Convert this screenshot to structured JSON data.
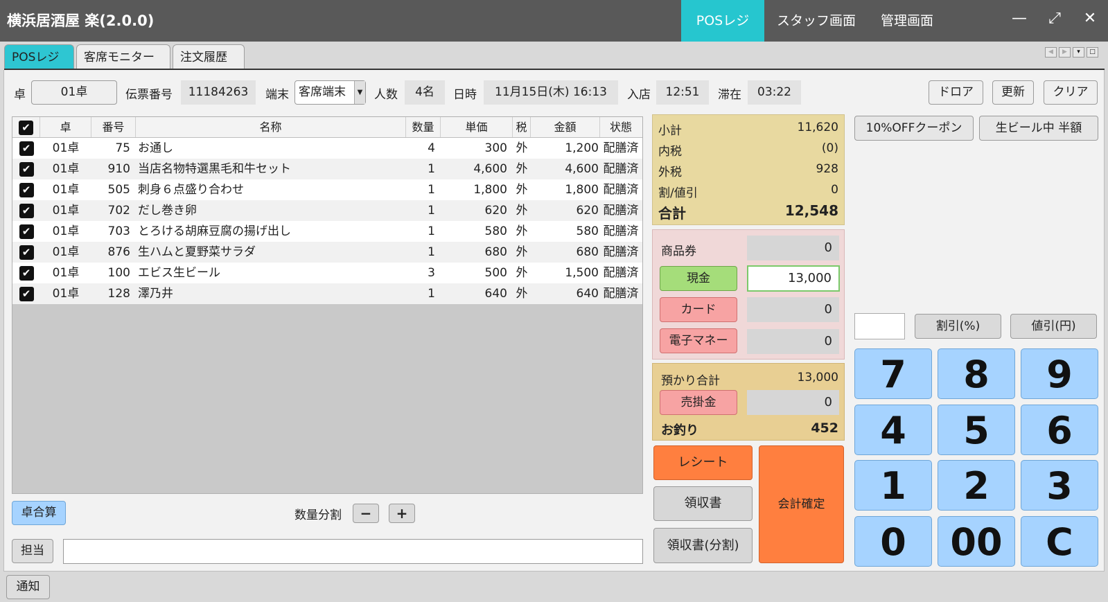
{
  "titlebar": {
    "app_title": "横浜居酒屋 楽(2.0.0)",
    "nav": [
      "POSレジ",
      "スタッフ画面",
      "管理画面"
    ],
    "minimize": "—",
    "maximize": "⤢",
    "close": "✕"
  },
  "tabs": [
    "POSレジ",
    "客席モニター",
    "注文履歴"
  ],
  "mini_controls": [
    "◀",
    "▶",
    "▾",
    "□"
  ],
  "header": {
    "table_label": "卓",
    "table_value": "01卓",
    "slip_label": "伝票番号",
    "slip_value": "11184263",
    "terminal_label": "端末",
    "terminal_value": "客席端末",
    "people_label": "人数",
    "people_value": "4名",
    "datetime_label": "日時",
    "datetime_value": "11月15日(木) 16:13",
    "entry_label": "入店",
    "entry_value": "12:51",
    "stay_label": "滞在",
    "stay_value": "03:22",
    "drawer_button": "ドロア",
    "refresh_button": "更新",
    "clear_button": "クリア"
  },
  "grid": {
    "columns": [
      "卓",
      "番号",
      "名称",
      "数量",
      "単価",
      "税",
      "金額",
      "状態"
    ],
    "rows": [
      {
        "table": "01卓",
        "no": "75",
        "name": "お通し",
        "qty": "4",
        "price": "300",
        "tax": "外",
        "amount": "1,200",
        "status": "配膳済"
      },
      {
        "table": "01卓",
        "no": "910",
        "name": "当店名物特選黒毛和牛セット",
        "qty": "1",
        "price": "4,600",
        "tax": "外",
        "amount": "4,600",
        "status": "配膳済"
      },
      {
        "table": "01卓",
        "no": "505",
        "name": "刺身６点盛り合わせ",
        "qty": "1",
        "price": "1,800",
        "tax": "外",
        "amount": "1,800",
        "status": "配膳済"
      },
      {
        "table": "01卓",
        "no": "702",
        "name": "だし巻き卵",
        "qty": "1",
        "price": "620",
        "tax": "外",
        "amount": "620",
        "status": "配膳済"
      },
      {
        "table": "01卓",
        "no": "703",
        "name": "とろける胡麻豆腐の揚げ出し",
        "qty": "1",
        "price": "580",
        "tax": "外",
        "amount": "580",
        "status": "配膳済"
      },
      {
        "table": "01卓",
        "no": "876",
        "name": " 生ハムと夏野菜サラダ",
        "qty": "1",
        "price": "680",
        "tax": "外",
        "amount": "680",
        "status": "配膳済"
      },
      {
        "table": "01卓",
        "no": "100",
        "name": "エビス生ビール",
        "qty": "3",
        "price": "500",
        "tax": "外",
        "amount": "1,500",
        "status": "配膳済"
      },
      {
        "table": "01卓",
        "no": "128",
        "name": "澤乃井",
        "qty": "1",
        "price": "640",
        "tax": "外",
        "amount": "640",
        "status": "配膳済"
      }
    ]
  },
  "bottom": {
    "table_merge": "卓合算",
    "qty_split_label": "数量分割",
    "minus": "−",
    "plus": "+",
    "staff_button": "担当",
    "notify_button": "通知"
  },
  "summary": {
    "subtotal_label": "小計",
    "subtotal": "11,620",
    "inner_tax_label": "内税",
    "inner_tax": "(0)",
    "outer_tax_label": "外税",
    "outer_tax": "928",
    "discount_label": "割/値引",
    "discount": "0",
    "total_label": "合計",
    "total": "12,548"
  },
  "payment": {
    "voucher_label": "商品券",
    "voucher": "0",
    "cash_button": "現金",
    "cash": "13,000",
    "card_button": "カード",
    "card": "0",
    "emoney_button": "電子マネー",
    "emoney": "0"
  },
  "deposit": {
    "deposit_label": "預かり合計",
    "deposit": "13,000",
    "credit_button": "売掛金",
    "credit": "0",
    "change_label": "お釣り",
    "change": "452"
  },
  "actions": {
    "receipt": "レシート",
    "invoice": "領収書",
    "invoice_split": "領収書(分割)",
    "confirm": "会計確定"
  },
  "coupons": [
    "10%OFFクーポン",
    "生ビール中 半額"
  ],
  "discount_buttons": {
    "percent": "割引(%)",
    "yen": "値引(円)"
  },
  "keypad": [
    "7",
    "8",
    "9",
    "4",
    "5",
    "6",
    "1",
    "2",
    "3",
    "0",
    "00",
    "C"
  ],
  "colors": {
    "titlebar": "#595959",
    "accent": "#26c6cf",
    "cash_green": "#a5dd7a",
    "pink_button": "#f7a3a3",
    "orange": "#ff7f3f",
    "keypad": "#a6d3ff"
  }
}
